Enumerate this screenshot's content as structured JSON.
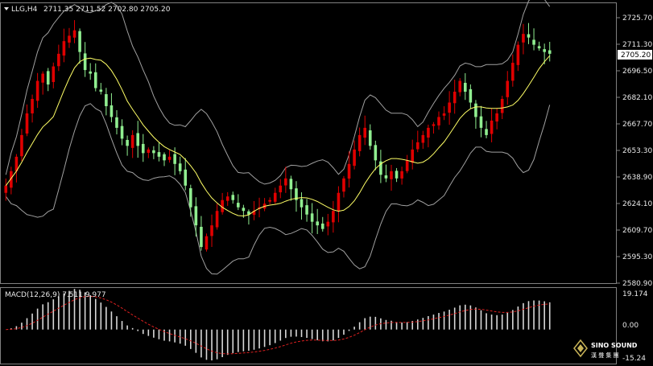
{
  "header": {
    "symbol_timeframe": "LLG,H4",
    "ohlc": "2711.35 2711.52 2702.80 2705.20"
  },
  "price_axis": {
    "ticks": [
      "2725.70",
      "2711.30",
      "2696.50",
      "2682.10",
      "2667.70",
      "2653.30",
      "2638.90",
      "2624.10",
      "2609.70",
      "2595.30",
      "2580.90"
    ],
    "current_price": "2705.20"
  },
  "macd": {
    "label": "MACD(12,26,9) 7.511 9.977",
    "ticks": [
      "19.174",
      "0.00",
      "-15.24"
    ]
  },
  "logo": {
    "line1": "SINO SOUND",
    "line2": "漢 聲 集 團"
  },
  "colors": {
    "background": "#000000",
    "bull": "#e00000",
    "bear": "#90ee90",
    "ma": "#ffff66",
    "bands": "#a0a0a0",
    "signal": "#e02020",
    "histogram": "#d8d8d8"
  },
  "chart_data": {
    "type": "candlestick",
    "symbol": "LLG",
    "timeframe": "H4",
    "ylim": [
      2578,
      2733
    ],
    "current_price": 2705.2,
    "closes": [
      2632,
      2640,
      2648,
      2660,
      2672,
      2680,
      2690,
      2694,
      2688,
      2698,
      2705,
      2712,
      2715,
      2718,
      2706,
      2696,
      2694,
      2686,
      2684,
      2676,
      2670,
      2664,
      2658,
      2654,
      2660,
      2654,
      2650,
      2652,
      2650,
      2648,
      2646,
      2648,
      2644,
      2640,
      2632,
      2620,
      2610,
      2598,
      2604,
      2610,
      2618,
      2624,
      2626,
      2624,
      2620,
      2618,
      2616,
      2618,
      2620,
      2622,
      2624,
      2628,
      2632,
      2636,
      2630,
      2624,
      2620,
      2616,
      2612,
      2610,
      2608,
      2612,
      2618,
      2628,
      2636,
      2644,
      2652,
      2660,
      2664,
      2654,
      2646,
      2638,
      2636,
      2640,
      2636,
      2640,
      2646,
      2652,
      2656,
      2660,
      2664,
      2666,
      2670,
      2672,
      2678,
      2684,
      2690,
      2684,
      2678,
      2670,
      2664,
      2660,
      2668,
      2672,
      2680,
      2690,
      2700,
      2710,
      2716,
      2714,
      2710,
      2708,
      2706,
      2705
    ],
    "macd_histogram_range": [
      -15.24,
      19.174
    ],
    "macd_value": 7.511,
    "macd_signal": 9.977
  }
}
